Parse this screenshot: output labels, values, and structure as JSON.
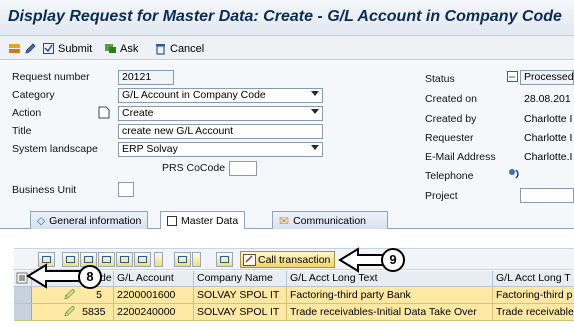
{
  "window": {
    "title": "Display Request for Master Data: Create - G/L Account in Company Code"
  },
  "toolbar": {
    "submit_label": "Submit",
    "ask_label": "Ask",
    "cancel_label": "Cancel"
  },
  "form": {
    "request_number_label": "Request number",
    "request_number_value": "20121",
    "category_label": "Category",
    "category_value": "G/L Account in Company Code",
    "action_label": "Action",
    "action_value": "Create",
    "title_label": "Title",
    "title_value": "create new G/L Account",
    "system_landscape_label": "System landscape",
    "system_landscape_value": "ERP Solvay",
    "prs_cocode_label": "PRS CoCode",
    "prs_cocode_value": "",
    "business_unit_label": "Business Unit",
    "business_unit_value": "",
    "status_label": "Status",
    "status_value": "Processed",
    "created_on_label": "Created on",
    "created_on_value": "28.08.201",
    "created_by_label": "Created by",
    "created_by_value": "Charlotte I",
    "requester_label": "Requester",
    "requester_value": "Charlotte I",
    "email_label": "E-Mail Address",
    "email_value": "Charlotte.I",
    "telephone_label": "Telephone",
    "project_label": "Project",
    "project_value": ""
  },
  "tabs": [
    {
      "label": "General information"
    },
    {
      "label": "Master Data"
    },
    {
      "label": "Communication"
    }
  ],
  "grid_toolbar": {
    "call_transaction_label": "Call transaction"
  },
  "grid": {
    "columns": [
      "de",
      "G/L Account",
      "Company Name",
      "G/L Acct Long Text",
      "G/L Acct Long T"
    ],
    "rows": [
      {
        "code": "5",
        "gl_account": "2200001600",
        "company_name": "SOLVAY SPOL IT",
        "long_text": "Factoring-third party Bank",
        "long_text2": "Factoring-third p"
      },
      {
        "code": "5835",
        "gl_account": "2200240000",
        "company_name": "SOLVAY SPOL IT",
        "long_text": "Trade receivables-Initial Data Take Over",
        "long_text2": "Trade receivable"
      }
    ]
  },
  "callouts": {
    "eight": "8",
    "nine": "9"
  },
  "colors": {
    "title": "#0a2b52",
    "row_highlight": "#fde9a3",
    "accent": "#f0d56a"
  }
}
